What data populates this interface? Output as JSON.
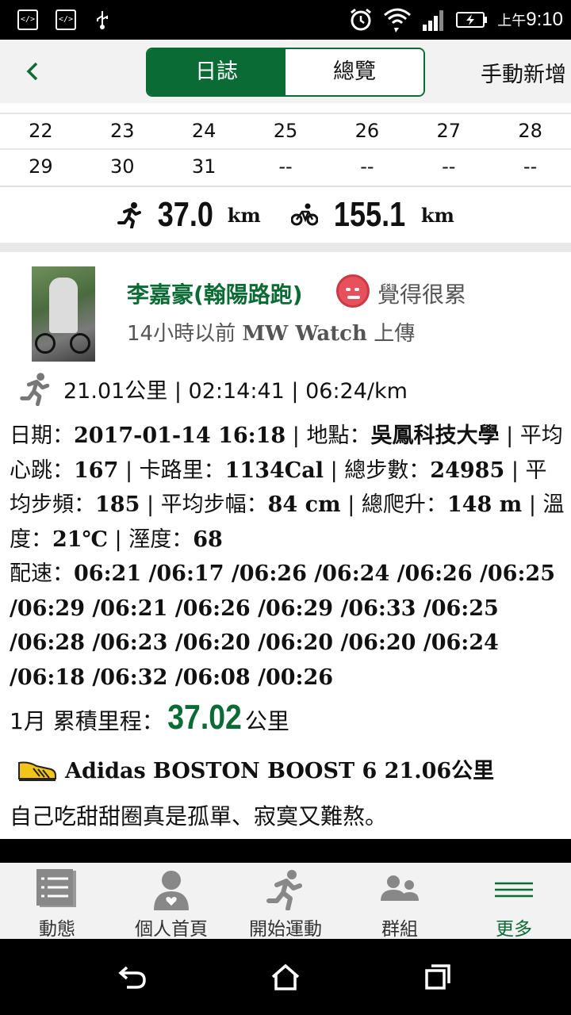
{
  "status_bar": {
    "left_icons": [
      "code-icon",
      "code-icon",
      "usb-icon"
    ],
    "right_icons": [
      "alarm-icon",
      "wifi-icon",
      "signal-icon",
      "battery-icon"
    ],
    "time_prefix": "上午",
    "time": "9:10"
  },
  "header": {
    "back_icon": "chevron-left-icon",
    "tabs": [
      {
        "label": "日誌",
        "active": true
      },
      {
        "label": "總覽",
        "active": false
      }
    ],
    "manual_add_label": "手動新增"
  },
  "calendar": {
    "rows": [
      [
        "22",
        "23",
        "24",
        "25",
        "26",
        "27",
        "28"
      ],
      [
        "29",
        "30",
        "31",
        "--",
        "--",
        "--",
        "--"
      ]
    ]
  },
  "totals": {
    "run_value": "37.0",
    "run_unit": "km",
    "bike_value": "155.1",
    "bike_unit": "km"
  },
  "post": {
    "user_name": "李嘉豪(翰陽路跑)",
    "mood_text": "覺得很累",
    "upload_time": "14小時以前",
    "upload_device": "MW Watch",
    "upload_suffix": "上傳",
    "summary": "21.01公里 | 02:14:41 | 06:24/km",
    "details": {
      "date_label": "日期：",
      "date_value": "2017-01-14 16:18",
      "location_label": " | 地點：",
      "location_value": "吳鳳科技大學",
      "hr_label": " | 平均心跳：",
      "hr_value": "167",
      "cal_label": " | 卡路里：",
      "cal_value": "1134Cal",
      "steps_label": " | 總步數：",
      "steps_value": "24985",
      "cadence_label": " | 平均步頻：",
      "cadence_value": "185",
      "stride_label": " | 平均步幅：",
      "stride_value": "84 cm",
      "climb_label": " | 總爬升：",
      "climb_value": "148 m",
      "temp_label": " | 溫度：",
      "temp_value": "21℃",
      "humidity_label": " | 溼度：",
      "humidity_value": "68"
    },
    "pace_label": "配速：",
    "pace_values": "06:21 /06:17 /06:26 /06:24 /06:26 /06:25 /06:29 /06:21 /06:26 /06:29 /06:33 /06:25 /06:28 /06:23 /06:20 /06:20 /06:20 /06:24 /06:18 /06:32 /06:08 /00:26",
    "cumulative_prefix": "1月 累積里程：",
    "cumulative_value": "37.02",
    "cumulative_unit": "公里",
    "shoe_text": "Adidas  BOSTON BOOST 6 21.06公里",
    "comment": "自己吃甜甜圈真是孤單、寂寞又難熬。"
  },
  "tabbar": [
    {
      "label": "動態",
      "icon": "feed-icon",
      "active": false
    },
    {
      "label": "個人首頁",
      "icon": "profile-icon",
      "active": false
    },
    {
      "label": "開始運動",
      "icon": "runner-icon",
      "active": false
    },
    {
      "label": "群組",
      "icon": "group-icon",
      "active": false
    },
    {
      "label": "更多",
      "icon": "menu-icon",
      "active": true
    }
  ],
  "system_nav": [
    "back-icon",
    "home-icon",
    "recents-icon"
  ]
}
